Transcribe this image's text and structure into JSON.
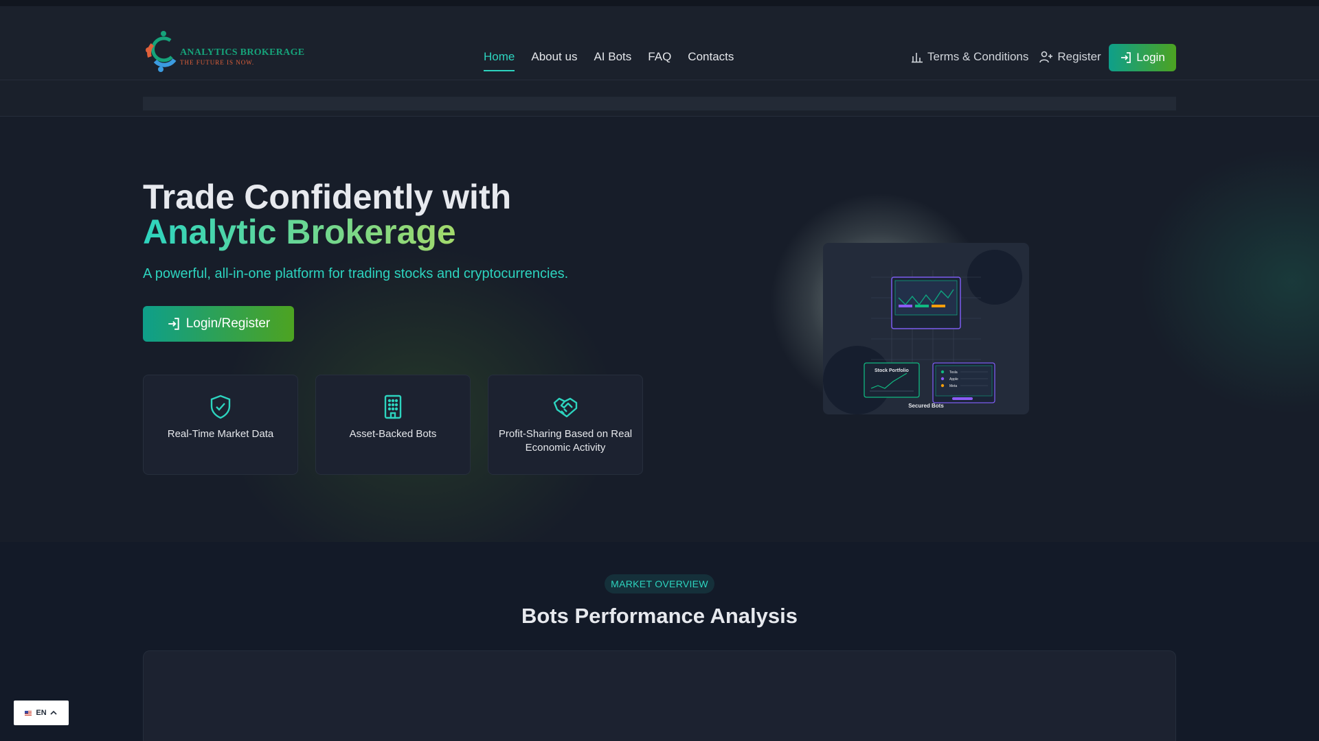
{
  "header": {
    "logo_title": "ANALYTICS BROKERAGE",
    "logo_tagline": "THE FUTURE IS NOW.",
    "nav": [
      "Home",
      "About us",
      "AI Bots",
      "FAQ",
      "Contacts"
    ],
    "active_nav": "Home",
    "terms_label": "Terms & Conditions",
    "register_label": "Register",
    "login_label": "Login"
  },
  "hero": {
    "title_line1": "Trade Confidently with",
    "title_line2": "Analytic Brokerage",
    "subtitle": "A powerful, all-in-one platform for trading stocks and cryptocurrencies.",
    "cta_label": "Login/Register",
    "features": [
      {
        "label": "Real-Time Market Data",
        "icon": "shield-check-icon"
      },
      {
        "label": "Asset-Backed Bots",
        "icon": "building-icon"
      },
      {
        "label": "Profit-Sharing Based on Real Economic Activity",
        "icon": "handshake-icon"
      }
    ],
    "illustration": {
      "stock_label": "Stock Portfolio",
      "list_items": [
        "Tesla",
        "Apple",
        "Meta"
      ],
      "caption": "Secured Bots"
    }
  },
  "market": {
    "badge": "MARKET OVERVIEW",
    "title": "Bots Performance Analysis"
  },
  "language": {
    "code": "EN"
  },
  "colors": {
    "accent_teal": "#2dd4bf",
    "accent_green": "#4da321",
    "background": "#171d29"
  }
}
